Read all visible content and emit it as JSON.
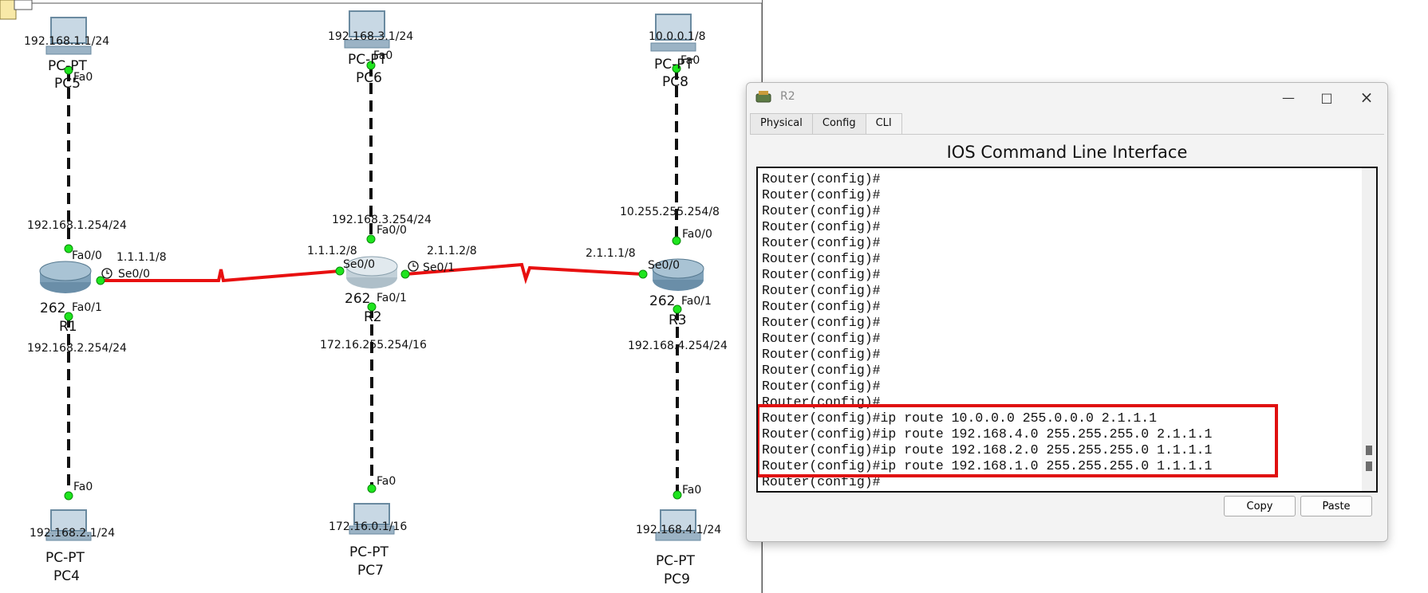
{
  "topology": {
    "pcs": [
      {
        "ip": "192.168.1.1/24",
        "type": "PC-PT",
        "name": "PC5",
        "port": "Fa0"
      },
      {
        "ip": "192.168.3.1/24",
        "type": "PC-PT",
        "name": "PC6",
        "port": "Fa0"
      },
      {
        "ip": "10.0.0.1/8",
        "type": "PC-PT",
        "name": "PC8",
        "port": "Fa0"
      },
      {
        "ip": "192.168.2.1/24",
        "type": "PC-PT",
        "name": "PC4",
        "port": "Fa0"
      },
      {
        "ip": "172.16.0.1/16",
        "type": "PC-PT",
        "name": "PC7",
        "port": "Fa0"
      },
      {
        "ip": "192.168.4.1/24",
        "type": "PC-PT",
        "name": "PC9",
        "port": "Fa0"
      }
    ],
    "routers": [
      {
        "name": "R1",
        "model": "262",
        "fa00_ip": "192.168.1.254/24",
        "fa00": "Fa0/0",
        "fa01": "Fa0/1",
        "fa01_ip": "192.168.2.254/24",
        "se_port": "Se0/0",
        "se_ip": "1.1.1.1/8"
      },
      {
        "name": "R2",
        "model": "262",
        "fa00_ip": "192.168.3.254/24",
        "fa00": "Fa0/0",
        "fa01": "Fa0/1",
        "fa01_ip": "172.16.255.254/16",
        "se_left_port": "Se0/0",
        "se_left_ip": "1.1.1.2/8",
        "se_right_port": "Se0/1",
        "se_right_ip": "2.1.1.2/8"
      },
      {
        "name": "R3",
        "model": "262",
        "fa00_ip": "10.255.255.254/8",
        "fa00": "Fa0/0",
        "fa01": "Fa0/1",
        "fa01_ip": "192.168.4.254/24",
        "se_port": "Se0/0",
        "se_ip": "2.1.1.1/8"
      }
    ],
    "colors": {
      "serial_link": "#e81010",
      "ethernet_link": "#111111",
      "port_up": "#1ee51e"
    }
  },
  "window": {
    "title": "R2",
    "tabs": [
      "Physical",
      "Config",
      "CLI"
    ],
    "active_tab": "CLI",
    "heading": "IOS Command Line Interface",
    "console_lines": [
      "Router(config)#",
      "Router(config)#",
      "Router(config)#",
      "Router(config)#",
      "Router(config)#",
      "Router(config)#",
      "Router(config)#",
      "Router(config)#",
      "Router(config)#",
      "Router(config)#",
      "Router(config)#",
      "Router(config)#",
      "Router(config)#",
      "Router(config)#",
      "Router(config)#",
      "Router(config)#ip route 10.0.0.0 255.0.0.0 2.1.1.1",
      "Router(config)#ip route 192.168.4.0 255.255.255.0 2.1.1.1",
      "Router(config)#ip route 192.168.2.0 255.255.255.0 1.1.1.1",
      "Router(config)#ip route 192.168.1.0 255.255.255.0 1.1.1.1",
      "Router(config)#"
    ],
    "highlight_color": "#e01010",
    "copy_label": "Copy",
    "paste_label": "Paste"
  }
}
